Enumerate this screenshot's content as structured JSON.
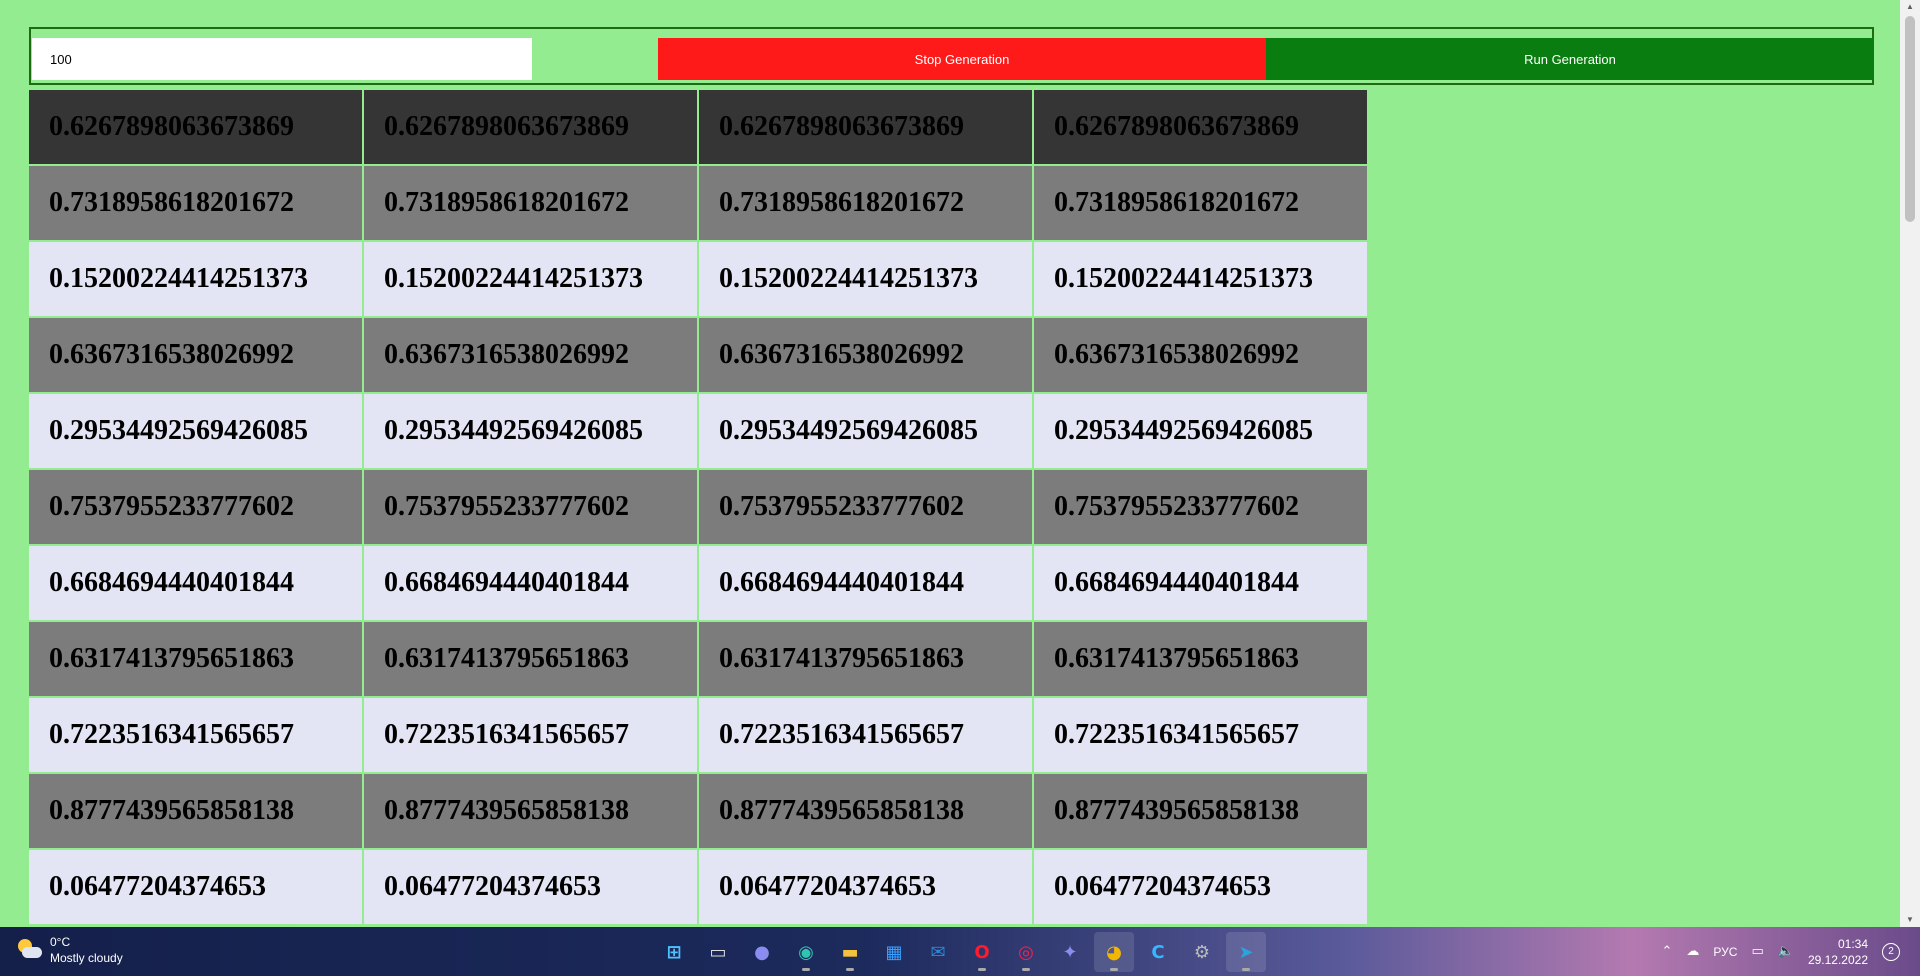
{
  "controls": {
    "count_value": "100",
    "stop_label": "Stop Generation",
    "run_label": "Run Generation"
  },
  "rows": [
    "0.6267898063673869",
    "0.7318958618201672",
    "0.15200224414251373",
    "0.6367316538026992",
    "0.29534492569426085",
    "0.7537955233777602",
    "0.6684694440401844",
    "0.6317413795651863",
    "0.7223516341565657",
    "0.8777439565858138",
    "0.06477204374653"
  ],
  "colors": {
    "background": "#94ec90",
    "stop_button": "#ff1a1a",
    "run_button": "#0a7d10",
    "row_dark": "#353535",
    "row_mid": "#7c7c7c",
    "row_light": "#e3e4f4"
  },
  "taskbar": {
    "weather_temp": "0°C",
    "weather_desc": "Mostly cloudy",
    "weather_icon": "partly-cloudy-icon",
    "language": "РУС",
    "time": "01:34",
    "date": "29.12.2022",
    "notification_count": "2",
    "apps": [
      "start-icon",
      "task-view-icon",
      "chat-icon",
      "edge-icon",
      "file-explorer-icon",
      "store-icon",
      "mail-icon",
      "opera-icon",
      "opera-gx-icon",
      "game-controller-icon",
      "chrome-icon",
      "c-app-icon",
      "settings-icon",
      "telegram-icon"
    ]
  }
}
